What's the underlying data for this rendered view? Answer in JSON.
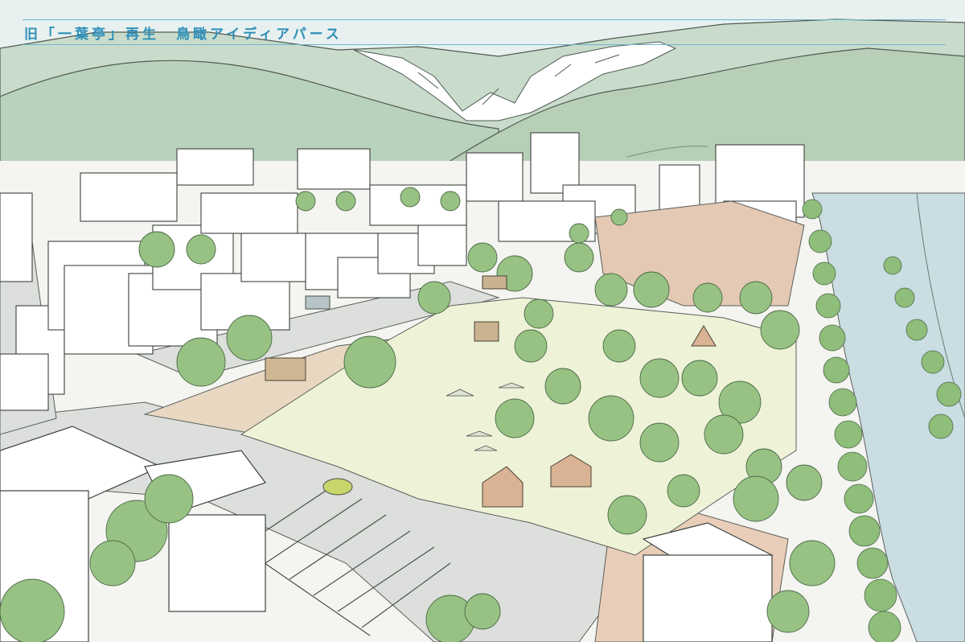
{
  "header": {
    "title": "旧「一葉亭」再生　鳥瞰アイディアパース"
  },
  "colors": {
    "title": "#2f8fb8",
    "rules": "#6fb6d3",
    "sky": "#e8f1ef",
    "mountains": "#b9d2bc",
    "snow": "#ffffff",
    "park": "#eef3d8",
    "plaza": "#e8d8c2",
    "river": "#c9dde3",
    "tree": "#8fbd7a",
    "road": "#d9dcd8"
  }
}
